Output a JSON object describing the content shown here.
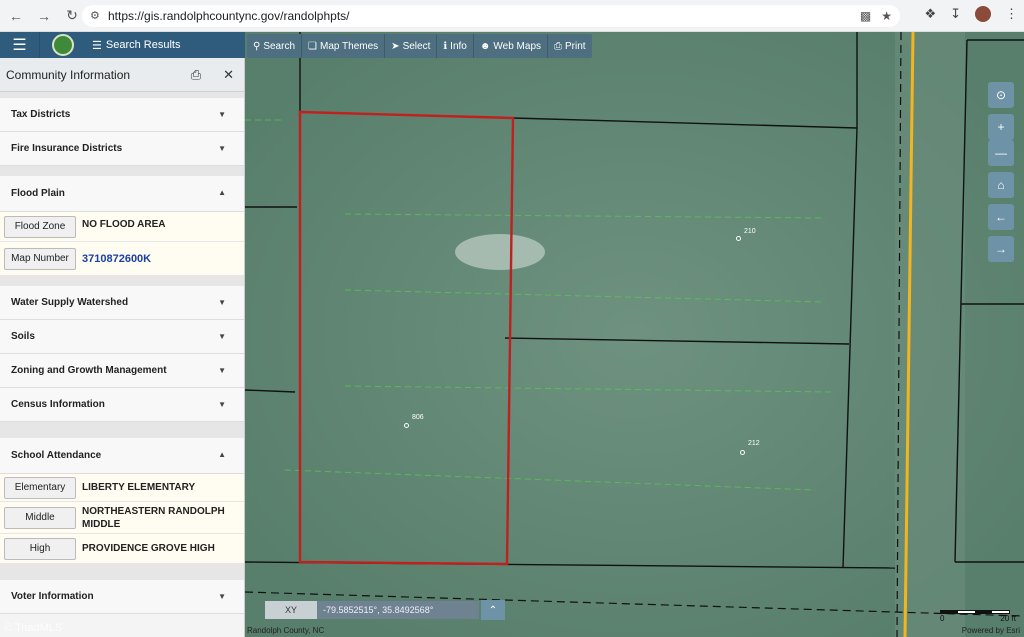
{
  "browser": {
    "url": "https://gis.randolphcountync.gov/randolphpts/"
  },
  "header": {
    "search_results_label": "Search Results"
  },
  "panel": {
    "title": "Community Information",
    "sections": {
      "tax": "Tax Districts",
      "fire": "Fire Insurance Districts",
      "flood": "Flood Plain",
      "water": "Water Supply Watershed",
      "soils": "Soils",
      "zoning": "Zoning and Growth Management",
      "census": "Census Information",
      "school": "School Attendance",
      "voter": "Voter Information"
    },
    "flood_rows": [
      {
        "label": "Flood Zone",
        "value": "NO FLOOD AREA"
      },
      {
        "label": "Map Number",
        "value": "3710872600K"
      }
    ],
    "school_rows": [
      {
        "label": "Elementary",
        "value": "LIBERTY ELEMENTARY"
      },
      {
        "label": "Middle",
        "value": "NORTHEASTERN RANDOLPH MIDDLE"
      },
      {
        "label": "High",
        "value": "PROVIDENCE GROVE HIGH"
      }
    ]
  },
  "toolbar": {
    "search": "Search",
    "themes": "Map Themes",
    "select": "Select",
    "info": "Info",
    "webmaps": "Web Maps",
    "print": "Print"
  },
  "map": {
    "parcels": [
      "806",
      "210",
      "212"
    ],
    "xy_label": "XY",
    "coords": "-79.5852515°, 35.8492568°",
    "scale_zero": "0",
    "scale_end": "20 ft",
    "credit_left": "Randolph County, NC",
    "credit_right": "Powered by Esri"
  },
  "watermark": "© TriadMLS",
  "colors": {
    "header": "#2f5c7d",
    "selected_parcel": "#c0201f",
    "road_line": "#f2b51d"
  }
}
